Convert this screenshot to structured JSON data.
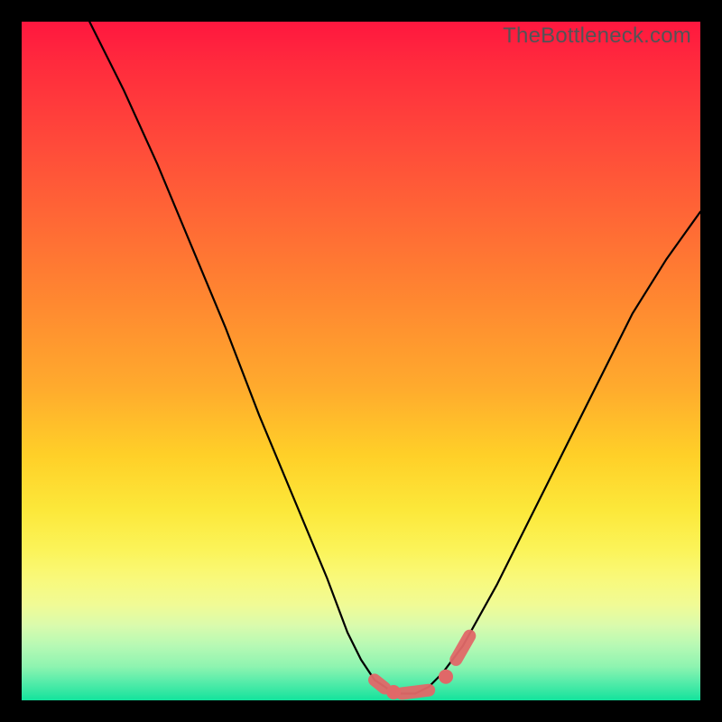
{
  "watermark": "TheBottleneck.com",
  "colors": {
    "frame": "#000000",
    "curve_stroke": "#000000",
    "marker_fill": "#e06868",
    "gradient_top": "#ff173f",
    "gradient_bottom": "#12e39c"
  },
  "chart_data": {
    "type": "line",
    "title": "",
    "xlabel": "",
    "ylabel": "",
    "xlim": [
      0,
      100
    ],
    "ylim": [
      0,
      100
    ],
    "series": [
      {
        "name": "bottleneck-curve",
        "x": [
          10,
          15,
          20,
          25,
          30,
          35,
          40,
          45,
          48,
          50,
          52,
          55,
          58,
          60,
          62,
          65,
          70,
          75,
          80,
          85,
          90,
          95,
          100
        ],
        "y": [
          100,
          90,
          79,
          67,
          55,
          42,
          30,
          18,
          10,
          6,
          3,
          1,
          1,
          2,
          4,
          8,
          17,
          27,
          37,
          47,
          57,
          65,
          72
        ]
      }
    ],
    "markers": [
      {
        "shape": "segment",
        "x": [
          52.0,
          53.5
        ],
        "y": [
          3.0,
          1.8
        ]
      },
      {
        "shape": "dot",
        "x": 54.8,
        "y": 1.2
      },
      {
        "shape": "segment",
        "x": [
          56.0,
          60.0
        ],
        "y": [
          1.0,
          1.5
        ]
      },
      {
        "shape": "dot",
        "x": 62.5,
        "y": 3.5
      },
      {
        "shape": "segment",
        "x": [
          64.0,
          66.0
        ],
        "y": [
          6.0,
          9.5
        ]
      }
    ],
    "grid": false,
    "legend": false
  }
}
